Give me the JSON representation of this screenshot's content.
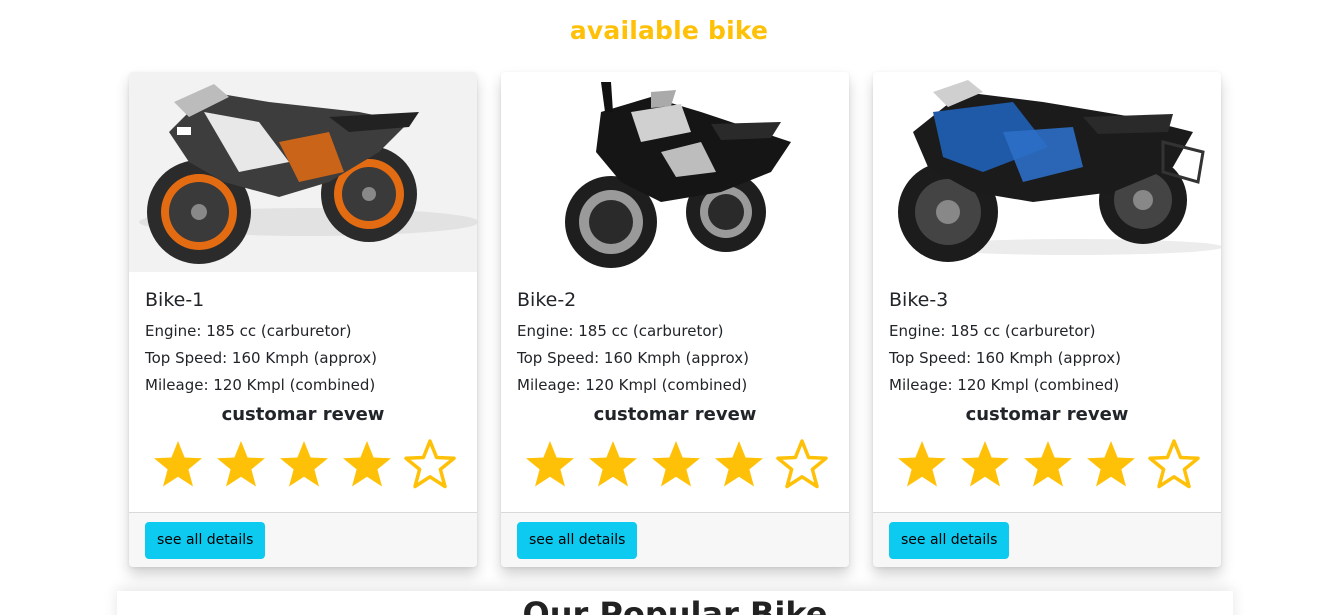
{
  "section": {
    "title": "available bike"
  },
  "bikes": [
    {
      "name": "Bike-1",
      "engine": "Engine: 185 cc (carburetor)",
      "speed": "Top Speed: 160 Kmph (approx)",
      "mileage": "Mileage: 120 Kmpl (combined)",
      "review_title": "customar revew",
      "rating": 4,
      "rating_max": 5,
      "button": "see all details",
      "image": "orange-black-sport-bike"
    },
    {
      "name": "Bike-2",
      "engine": "Engine: 185 cc (carburetor)",
      "speed": "Top Speed: 160 Kmph (approx)",
      "mileage": "Mileage: 120 Kmpl (combined)",
      "review_title": "customar revew",
      "rating": 4,
      "rating_max": 5,
      "button": "see all details",
      "image": "black-silver-sport-bike"
    },
    {
      "name": "Bike-3",
      "engine": "Engine: 185 cc (carburetor)",
      "speed": "Top Speed: 160 Kmph (approx)",
      "mileage": "Mileage: 120 Kmpl (combined)",
      "review_title": "customar revew",
      "rating": 4,
      "rating_max": 5,
      "button": "see all details",
      "image": "blue-black-sport-bike"
    }
  ],
  "popular": {
    "title": "Our Popular Bike"
  },
  "colors": {
    "accent": "#ffc107",
    "button": "#0dcaf0"
  }
}
